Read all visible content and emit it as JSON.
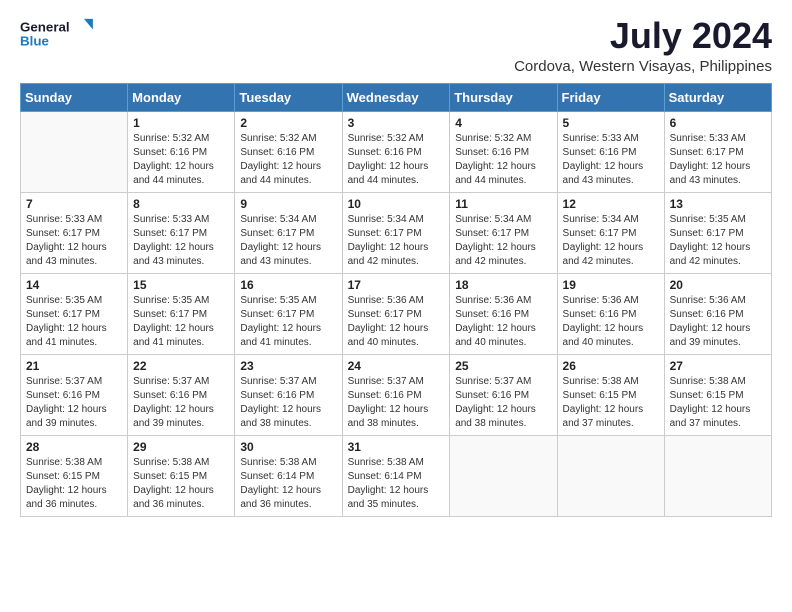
{
  "logo": {
    "line1": "General",
    "line2": "Blue"
  },
  "title": "July 2024",
  "location": "Cordova, Western Visayas, Philippines",
  "days_header": [
    "Sunday",
    "Monday",
    "Tuesday",
    "Wednesday",
    "Thursday",
    "Friday",
    "Saturday"
  ],
  "weeks": [
    [
      {
        "day": "",
        "info": ""
      },
      {
        "day": "1",
        "info": "Sunrise: 5:32 AM\nSunset: 6:16 PM\nDaylight: 12 hours\nand 44 minutes."
      },
      {
        "day": "2",
        "info": "Sunrise: 5:32 AM\nSunset: 6:16 PM\nDaylight: 12 hours\nand 44 minutes."
      },
      {
        "day": "3",
        "info": "Sunrise: 5:32 AM\nSunset: 6:16 PM\nDaylight: 12 hours\nand 44 minutes."
      },
      {
        "day": "4",
        "info": "Sunrise: 5:32 AM\nSunset: 6:16 PM\nDaylight: 12 hours\nand 44 minutes."
      },
      {
        "day": "5",
        "info": "Sunrise: 5:33 AM\nSunset: 6:16 PM\nDaylight: 12 hours\nand 43 minutes."
      },
      {
        "day": "6",
        "info": "Sunrise: 5:33 AM\nSunset: 6:17 PM\nDaylight: 12 hours\nand 43 minutes."
      }
    ],
    [
      {
        "day": "7",
        "info": "Sunrise: 5:33 AM\nSunset: 6:17 PM\nDaylight: 12 hours\nand 43 minutes."
      },
      {
        "day": "8",
        "info": "Sunrise: 5:33 AM\nSunset: 6:17 PM\nDaylight: 12 hours\nand 43 minutes."
      },
      {
        "day": "9",
        "info": "Sunrise: 5:34 AM\nSunset: 6:17 PM\nDaylight: 12 hours\nand 43 minutes."
      },
      {
        "day": "10",
        "info": "Sunrise: 5:34 AM\nSunset: 6:17 PM\nDaylight: 12 hours\nand 42 minutes."
      },
      {
        "day": "11",
        "info": "Sunrise: 5:34 AM\nSunset: 6:17 PM\nDaylight: 12 hours\nand 42 minutes."
      },
      {
        "day": "12",
        "info": "Sunrise: 5:34 AM\nSunset: 6:17 PM\nDaylight: 12 hours\nand 42 minutes."
      },
      {
        "day": "13",
        "info": "Sunrise: 5:35 AM\nSunset: 6:17 PM\nDaylight: 12 hours\nand 42 minutes."
      }
    ],
    [
      {
        "day": "14",
        "info": "Sunrise: 5:35 AM\nSunset: 6:17 PM\nDaylight: 12 hours\nand 41 minutes."
      },
      {
        "day": "15",
        "info": "Sunrise: 5:35 AM\nSunset: 6:17 PM\nDaylight: 12 hours\nand 41 minutes."
      },
      {
        "day": "16",
        "info": "Sunrise: 5:35 AM\nSunset: 6:17 PM\nDaylight: 12 hours\nand 41 minutes."
      },
      {
        "day": "17",
        "info": "Sunrise: 5:36 AM\nSunset: 6:17 PM\nDaylight: 12 hours\nand 40 minutes."
      },
      {
        "day": "18",
        "info": "Sunrise: 5:36 AM\nSunset: 6:16 PM\nDaylight: 12 hours\nand 40 minutes."
      },
      {
        "day": "19",
        "info": "Sunrise: 5:36 AM\nSunset: 6:16 PM\nDaylight: 12 hours\nand 40 minutes."
      },
      {
        "day": "20",
        "info": "Sunrise: 5:36 AM\nSunset: 6:16 PM\nDaylight: 12 hours\nand 39 minutes."
      }
    ],
    [
      {
        "day": "21",
        "info": "Sunrise: 5:37 AM\nSunset: 6:16 PM\nDaylight: 12 hours\nand 39 minutes."
      },
      {
        "day": "22",
        "info": "Sunrise: 5:37 AM\nSunset: 6:16 PM\nDaylight: 12 hours\nand 39 minutes."
      },
      {
        "day": "23",
        "info": "Sunrise: 5:37 AM\nSunset: 6:16 PM\nDaylight: 12 hours\nand 38 minutes."
      },
      {
        "day": "24",
        "info": "Sunrise: 5:37 AM\nSunset: 6:16 PM\nDaylight: 12 hours\nand 38 minutes."
      },
      {
        "day": "25",
        "info": "Sunrise: 5:37 AM\nSunset: 6:16 PM\nDaylight: 12 hours\nand 38 minutes."
      },
      {
        "day": "26",
        "info": "Sunrise: 5:38 AM\nSunset: 6:15 PM\nDaylight: 12 hours\nand 37 minutes."
      },
      {
        "day": "27",
        "info": "Sunrise: 5:38 AM\nSunset: 6:15 PM\nDaylight: 12 hours\nand 37 minutes."
      }
    ],
    [
      {
        "day": "28",
        "info": "Sunrise: 5:38 AM\nSunset: 6:15 PM\nDaylight: 12 hours\nand 36 minutes."
      },
      {
        "day": "29",
        "info": "Sunrise: 5:38 AM\nSunset: 6:15 PM\nDaylight: 12 hours\nand 36 minutes."
      },
      {
        "day": "30",
        "info": "Sunrise: 5:38 AM\nSunset: 6:14 PM\nDaylight: 12 hours\nand 36 minutes."
      },
      {
        "day": "31",
        "info": "Sunrise: 5:38 AM\nSunset: 6:14 PM\nDaylight: 12 hours\nand 35 minutes."
      },
      {
        "day": "",
        "info": ""
      },
      {
        "day": "",
        "info": ""
      },
      {
        "day": "",
        "info": ""
      }
    ]
  ]
}
